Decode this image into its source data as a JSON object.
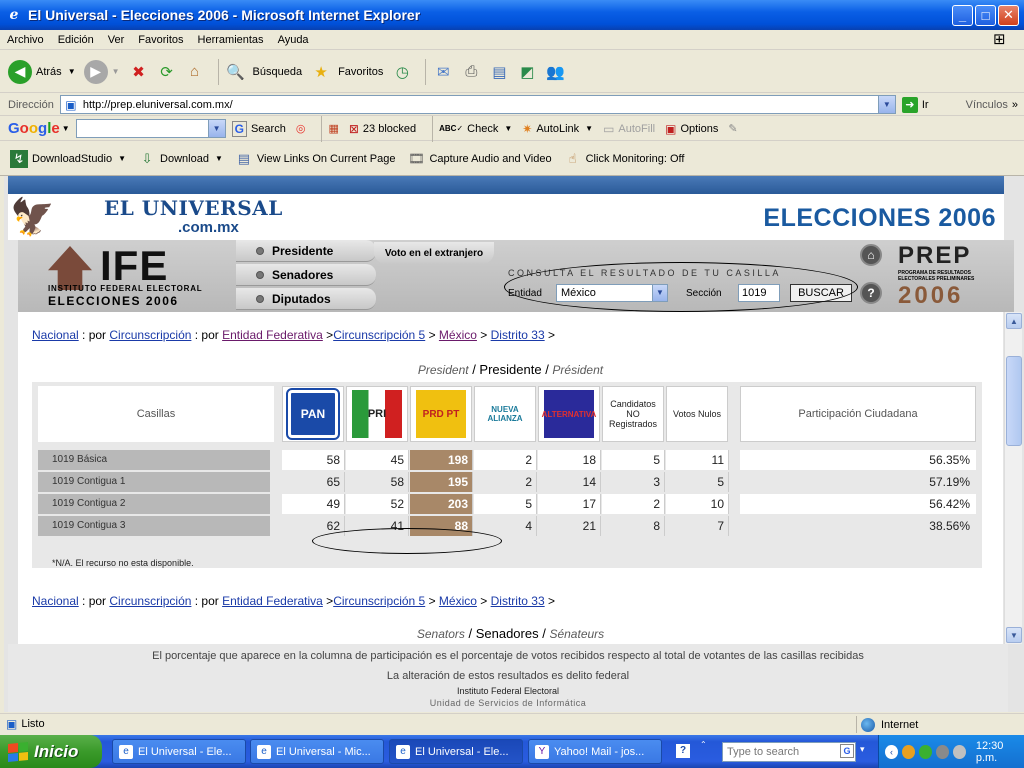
{
  "window": {
    "title": "El Universal - Elecciones 2006 - Microsoft Internet Explorer"
  },
  "menu": [
    "Archivo",
    "Edición",
    "Ver",
    "Favoritos",
    "Herramientas",
    "Ayuda"
  ],
  "toolbar": {
    "back": "Atrás",
    "search": "Búsqueda",
    "favorites": "Favoritos"
  },
  "address": {
    "label": "Dirección",
    "url": "http://prep.eluniversal.com.mx/",
    "go": "Ir",
    "links": "Vínculos"
  },
  "google": {
    "search": "Search",
    "blocked": "23 blocked",
    "check": "Check",
    "autolink": "AutoLink",
    "autofill": "AutoFill",
    "options": "Options"
  },
  "dlbar": {
    "downloadstudio": "DownloadStudio",
    "download": "Download",
    "viewlinks": "View Links On Current Page",
    "capture": "Capture Audio and Video",
    "monitoring": "Click Monitoring: Off"
  },
  "header": {
    "brand": "EL UNIVERSAL",
    "brand_sub": ".com.mx",
    "elecciones": "ELECCIONES 2006"
  },
  "ife": {
    "logo": "IFE",
    "sub1": "INSTITUTO FEDERAL ELECTORAL",
    "sub2": "ELECCIONES 2006",
    "tabs": [
      "Presidente",
      "Senadores",
      "Diputados"
    ],
    "voto_ext": "Voto en el extranjero",
    "consulta": "CONSULTA EL RESULTADO DE TU CASILLA",
    "entidad_label": "Entidad",
    "entidad_value": "México",
    "seccion_label": "Sección",
    "seccion_value": "1019",
    "buscar": "BUSCAR",
    "prep": "PREP",
    "prep_sub": "PROGRAMA DE RESULTADOS ELECTORALES PRELIMINARES",
    "prep_year": "2006"
  },
  "breadcrumb": {
    "nacional": "Nacional",
    "por1": " : por ",
    "circ": "Circunscripción",
    "por2": " : por ",
    "entidad": "Entidad Federativa",
    "gt1": " >",
    "circ5": "Circunscripción 5",
    "gt2": " > ",
    "mexico": "México",
    "gt3": " > ",
    "distrito": "Distrito 33",
    "gt4": " >"
  },
  "presidente": {
    "en": "President",
    "es": "Presidente",
    "fr": "Président",
    "slash": " / "
  },
  "senadores": {
    "en": "Senators",
    "es": "Senadores",
    "fr": "Sénateurs",
    "slash": " / "
  },
  "table": {
    "casillas": "Casillas",
    "parties": [
      "PAN",
      "PRI",
      "PRD PT",
      "NUEVA ALIANZA",
      "ALTERNATIVA"
    ],
    "no_reg": "Candidatos NO Registrados",
    "nulos": "Votos Nulos",
    "participacion": "Participación Ciudadana",
    "rows": [
      {
        "label": "1019 Básica",
        "values": [
          "58",
          "45",
          "198",
          "2",
          "18",
          "5",
          "11"
        ],
        "part": "56.35%"
      },
      {
        "label": "1019 Contigua 1",
        "values": [
          "65",
          "58",
          "195",
          "2",
          "14",
          "3",
          "5"
        ],
        "part": "57.19%"
      },
      {
        "label": "1019 Contigua 2",
        "values": [
          "49",
          "52",
          "203",
          "5",
          "17",
          "2",
          "10"
        ],
        "part": "56.42%"
      },
      {
        "label": "1019 Contigua 3",
        "values": [
          "62",
          "41",
          "88",
          "4",
          "21",
          "8",
          "7"
        ],
        "part": "38.56%"
      }
    ],
    "note": "*N/A. El recurso no esta disponible."
  },
  "footer": {
    "line1": "El porcentaje que aparece en la columna de participación es el porcentaje de votos recibidos respecto al total de votantes de las casillas recibidas",
    "line2": "La alteración de estos resultados es delito federal",
    "line3": "Instituto Federal Electoral",
    "line4": "Unidad de Servicios de Informática"
  },
  "status": {
    "left": "Listo",
    "zone": "Internet"
  },
  "taskbar": {
    "start": "Inicio",
    "tasks": [
      "El Universal - Ele...",
      "El Universal - Mic...",
      "El Universal - Ele...",
      "Yahoo! Mail - jos..."
    ],
    "search_placeholder": "Type to search",
    "time": "12:30 p.m."
  }
}
